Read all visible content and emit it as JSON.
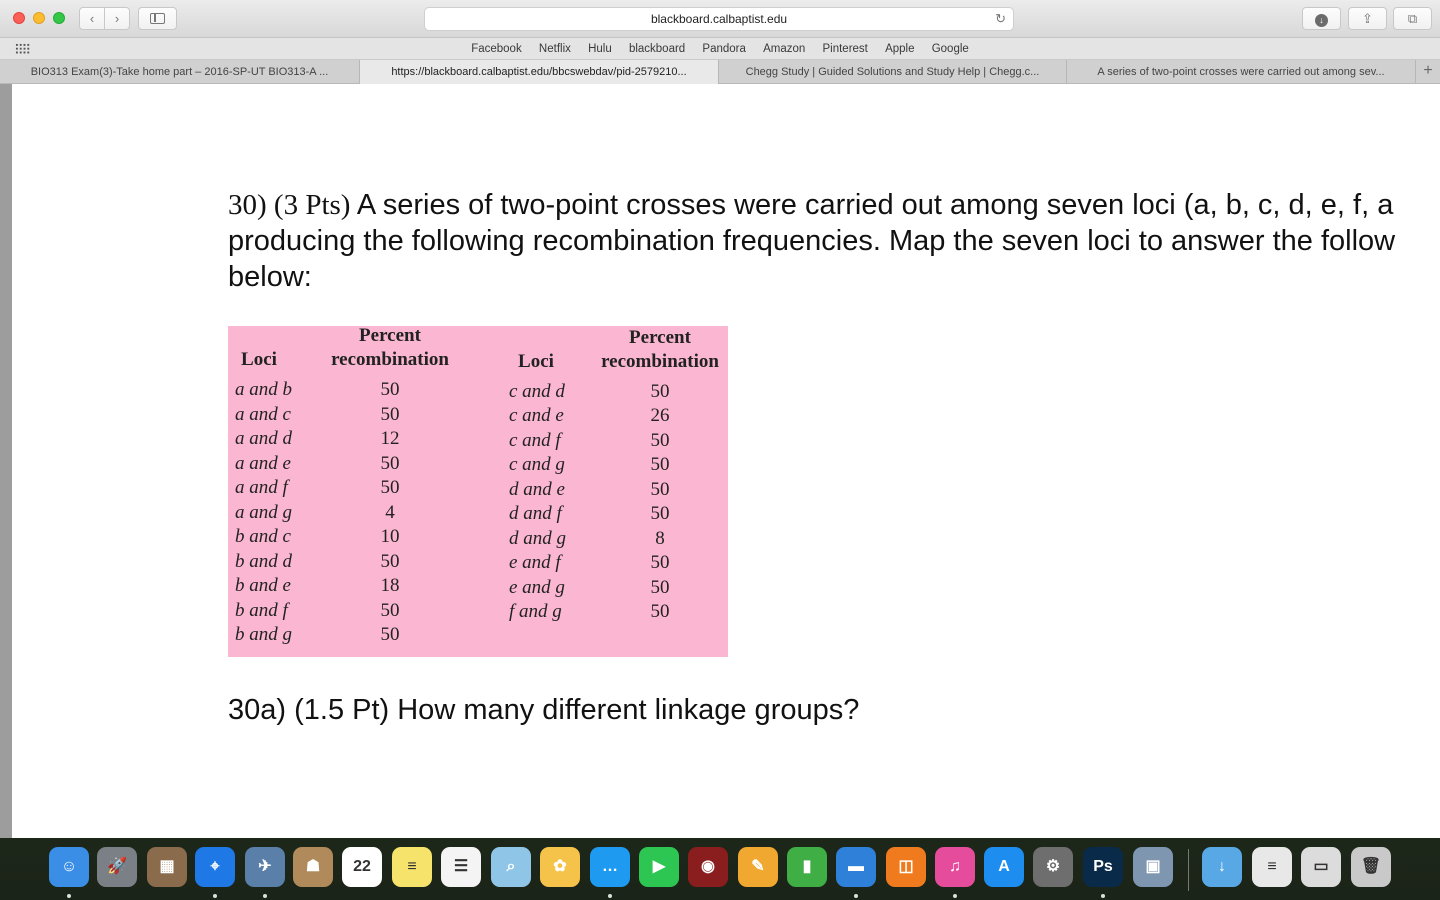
{
  "browser": {
    "address": "blackboard.calbaptist.edu",
    "favorites": [
      "Facebook",
      "Netflix",
      "Hulu",
      "blackboard",
      "Pandora",
      "Amazon",
      "Pinterest",
      "Apple",
      "Google"
    ],
    "tabs": [
      "BIO313 Exam(3)-Take home part – 2016-SP-UT BIO313-A ...",
      "https://blackboard.calbaptist.edu/bbcswebdav/pid-2579210...",
      "Chegg Study | Guided Solutions and Study Help | Chegg.c...",
      "A series of two-point crosses were carried out among sev..."
    ],
    "active_tab": 1,
    "glyphs": {
      "back": "‹",
      "forward": "›",
      "reload": "↻",
      "download": "↓",
      "share": "⇪",
      "tabs": "⧉",
      "new_tab": "+"
    }
  },
  "question": {
    "lead": "30) (3 Pts)",
    "line1": " A series of two-point crosses were carried out among seven loci (a, b, c, d, e, f, a",
    "line2": "producing the following recombination frequencies.  Map the seven loci to answer the follow",
    "line3": "below:"
  },
  "table": {
    "headers": {
      "loci": "Loci",
      "percent": "Percent",
      "recombination": "recombination"
    },
    "left": [
      {
        "loci": "a and b",
        "pct": "50"
      },
      {
        "loci": "a and c",
        "pct": "50"
      },
      {
        "loci": "a and d",
        "pct": "12"
      },
      {
        "loci": "a and e",
        "pct": "50"
      },
      {
        "loci": "a and f",
        "pct": "50"
      },
      {
        "loci": "a and g",
        "pct": "4"
      },
      {
        "loci": "b and c",
        "pct": "10"
      },
      {
        "loci": "b and d",
        "pct": "50"
      },
      {
        "loci": "b and e",
        "pct": "18"
      },
      {
        "loci": "b and f",
        "pct": "50"
      },
      {
        "loci": "b and g",
        "pct": "50"
      }
    ],
    "right": [
      {
        "loci": "c and d",
        "pct": "50"
      },
      {
        "loci": "c and e",
        "pct": "26"
      },
      {
        "loci": "c and f",
        "pct": "50"
      },
      {
        "loci": "c and g",
        "pct": "50"
      },
      {
        "loci": "d and e",
        "pct": "50"
      },
      {
        "loci": "d and f",
        "pct": "50"
      },
      {
        "loci": "d and g",
        "pct": "8"
      },
      {
        "loci": "e and f",
        "pct": "50"
      },
      {
        "loci": "e and g",
        "pct": "50"
      },
      {
        "loci": "f and g",
        "pct": "50"
      }
    ]
  },
  "subquestion": "30a) (1.5 Pt) How many different linkage groups?",
  "dock": {
    "apps": [
      {
        "name": "finder-icon",
        "color": "#3a8ee6",
        "glyph": "☺",
        "running": true
      },
      {
        "name": "launchpad-icon",
        "color": "#7b7f86",
        "glyph": "🚀",
        "running": false
      },
      {
        "name": "calculator-icon",
        "color": "#8a6b4b",
        "glyph": "▦",
        "running": false
      },
      {
        "name": "safari-icon",
        "color": "#1e78e6",
        "glyph": "⌖",
        "running": true
      },
      {
        "name": "preview-icon",
        "color": "#5a7fa8",
        "glyph": "✈",
        "running": true
      },
      {
        "name": "contacts-icon",
        "color": "#b08a5a",
        "glyph": "☗",
        "running": false
      },
      {
        "name": "calendar-icon",
        "color": "#ffffff",
        "glyph": "22",
        "running": false
      },
      {
        "name": "notes-icon",
        "color": "#f5e36c",
        "glyph": "≡",
        "running": false
      },
      {
        "name": "reminders-icon",
        "color": "#f4f4f4",
        "glyph": "☰",
        "running": false
      },
      {
        "name": "maps-icon",
        "color": "#8fc6e8",
        "glyph": "⌕",
        "running": false
      },
      {
        "name": "photos-icon",
        "color": "#f6c34a",
        "glyph": "✿",
        "running": false
      },
      {
        "name": "messages-icon",
        "color": "#1e9bf0",
        "glyph": "…",
        "running": true
      },
      {
        "name": "facetime-icon",
        "color": "#2dc653",
        "glyph": "▶",
        "running": false
      },
      {
        "name": "photo-booth-icon",
        "color": "#8a1d1d",
        "glyph": "◉",
        "running": false
      },
      {
        "name": "pages-icon",
        "color": "#f0a830",
        "glyph": "✎",
        "running": false
      },
      {
        "name": "numbers-icon",
        "color": "#3fae44",
        "glyph": "▮",
        "running": false
      },
      {
        "name": "keynote-icon",
        "color": "#2f80d8",
        "glyph": "▬",
        "running": true
      },
      {
        "name": "ibooks-icon",
        "color": "#f07b1e",
        "glyph": "◫",
        "running": false
      },
      {
        "name": "itunes-icon",
        "color": "#e64c9c",
        "glyph": "♫",
        "running": true
      },
      {
        "name": "app-store-icon",
        "color": "#1d8ef0",
        "glyph": "A",
        "running": false
      },
      {
        "name": "system-preferences-icon",
        "color": "#6e6e6e",
        "glyph": "⚙",
        "running": false
      },
      {
        "name": "photoshop-icon",
        "color": "#0a2a4a",
        "glyph": "Ps",
        "running": true
      },
      {
        "name": "image-capture-icon",
        "color": "#7f96b0",
        "glyph": "▣",
        "running": false
      },
      {
        "name": "downloads-folder-icon",
        "color": "#58a8e6",
        "glyph": "↓",
        "running": false
      },
      {
        "name": "document-stack-icon",
        "color": "#e8e8e8",
        "glyph": "≡",
        "running": false
      },
      {
        "name": "screenshot-stack-icon",
        "color": "#dcdcdc",
        "glyph": "▭",
        "running": false
      },
      {
        "name": "trash-icon",
        "color": "#c9c9c9",
        "glyph": "🗑",
        "running": false
      }
    ]
  }
}
